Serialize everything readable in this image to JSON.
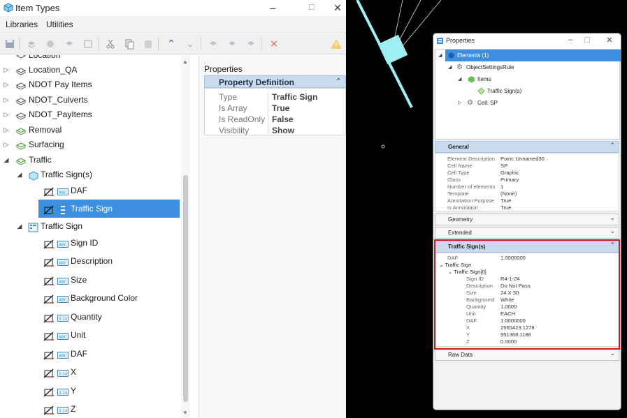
{
  "item_types_window": {
    "title": "Item Types",
    "menus": [
      "Libraries",
      "Utilities"
    ],
    "tree": {
      "partial_top": "Location",
      "libraries": [
        "Location_QA",
        "NDOT Pay Items",
        "NDOT_Culverts",
        "NDOT_PayItems",
        "Removal",
        "Surfacing",
        "Traffic"
      ],
      "traffic_signs_group": "Traffic Sign(s)",
      "traffic_signs_children": [
        "DAF",
        "Traffic Sign"
      ],
      "traffic_sign_type": "Traffic Sign",
      "traffic_sign_properties": [
        "Sign ID",
        "Description",
        "Size",
        "Background Color",
        "Quantity",
        "Unit",
        "DAF",
        "X",
        "Y",
        "Z"
      ]
    },
    "properties_panel": {
      "label": "Properties",
      "section_title": "Property Definition",
      "rows": [
        {
          "key": "Type",
          "value": "Traffic Sign"
        },
        {
          "key": "Is Array",
          "value": "True"
        },
        {
          "key": "Is ReadOnly",
          "value": "False"
        },
        {
          "key": "Visibility",
          "value": "Show"
        }
      ]
    }
  },
  "properties_window": {
    "title": "Properties",
    "tree": {
      "elements": "Elements (1)",
      "rule": "ObjectSettingsRule",
      "items": "Items",
      "item_child": "Traffic Sign(s)",
      "cell": "Cell: SP"
    },
    "sections": {
      "general": "General",
      "geometry": "Geometry",
      "extended": "Extended",
      "traffic_signs": "Traffic Sign(s)",
      "raw_data": "Raw Data"
    },
    "general_rows": [
      {
        "key": "Element Description",
        "value": "Point: Unnamed30"
      },
      {
        "key": "Cell Name",
        "value": "SP"
      },
      {
        "key": "Cell Type",
        "value": "Graphic"
      },
      {
        "key": "Class",
        "value": "Primary"
      },
      {
        "key": "Number of elements",
        "value": "1"
      },
      {
        "key": "Template",
        "value": "(None)"
      },
      {
        "key": "Annotation Purpose",
        "value": "True"
      },
      {
        "key": "Is Annotation",
        "value": "True"
      }
    ],
    "traffic": {
      "daf_key": "DAF",
      "daf_value": "1.0000000",
      "group": "Traffic Sign",
      "subgroup": "Traffic Sign[0]",
      "rows": [
        {
          "key": "Sign ID",
          "value": "R4-1-24"
        },
        {
          "key": "Description",
          "value": "Do Not Pass"
        },
        {
          "key": "Size",
          "value": "24 X 30"
        },
        {
          "key": "Background",
          "value": "White"
        },
        {
          "key": "Quantity",
          "value": "1.0000"
        },
        {
          "key": "Unit",
          "value": "EACH"
        },
        {
          "key": "DAF",
          "value": "1.0000000"
        },
        {
          "key": "X",
          "value": "2565423.1278"
        },
        {
          "key": "Y",
          "value": "951368.1188"
        },
        {
          "key": "Z",
          "value": "0.0000"
        }
      ]
    }
  },
  "colors": {
    "selection": "#3d8fe0",
    "highlight_border": "#d11a1a",
    "cyan_shape": "#9ff0f5"
  }
}
